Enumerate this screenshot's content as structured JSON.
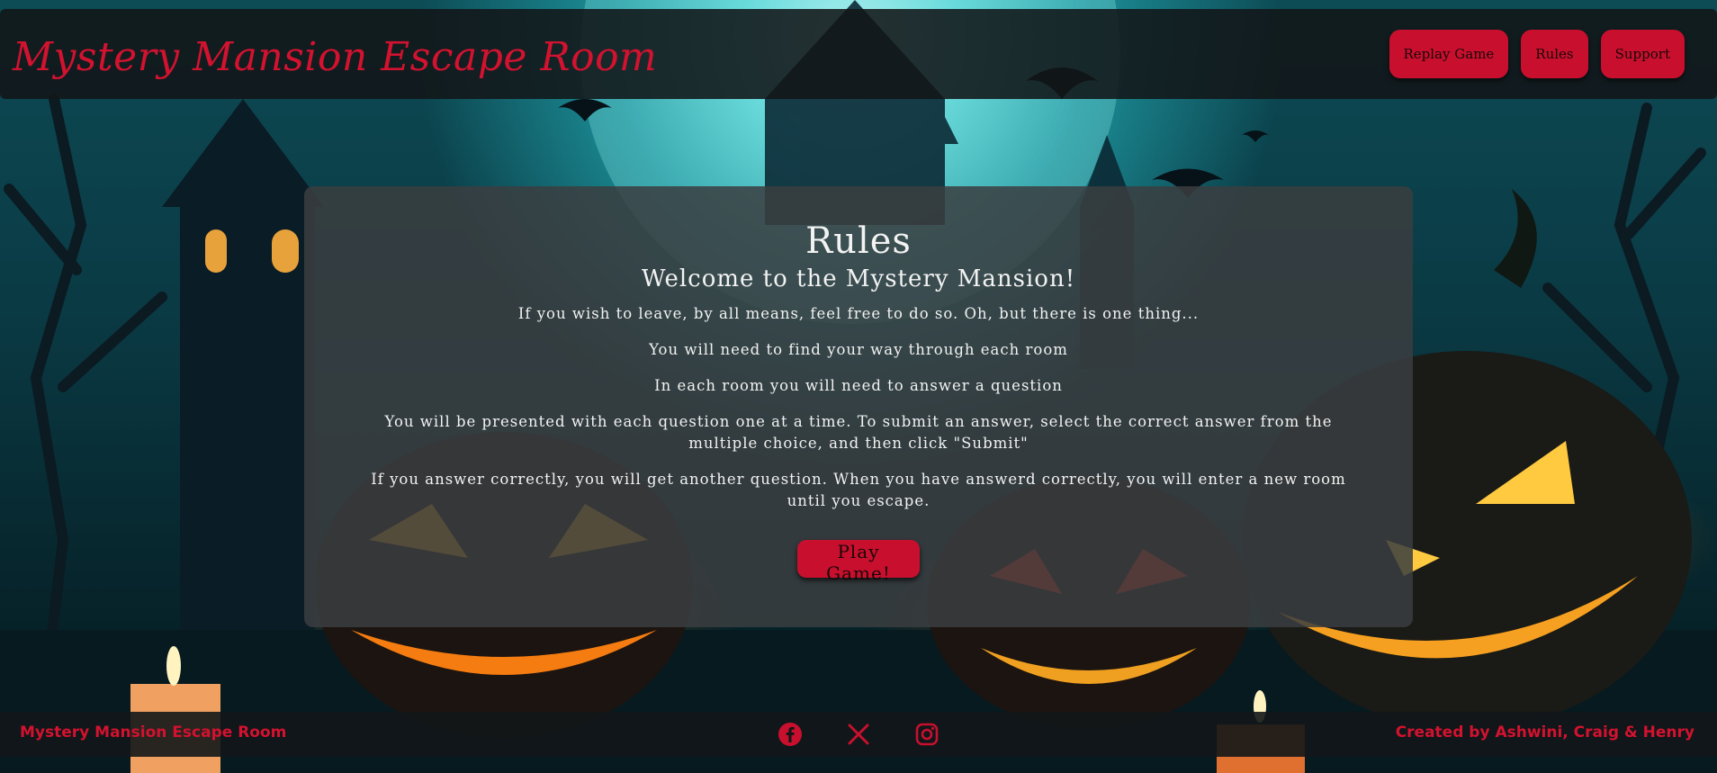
{
  "header": {
    "brand": "Mystery Mansion Escape Room",
    "nav": {
      "replay": "Replay Game",
      "rules": "Rules",
      "support": "Support"
    }
  },
  "rules": {
    "title": "Rules",
    "subtitle": "Welcome to the Mystery Mansion!",
    "paragraphs": [
      "If you wish to leave, by all means, feel free to do so. Oh, but there is one thing...",
      "You will need to find your way through each room",
      "In each room you will need to answer a question",
      "You will be presented with each question one at a time. To submit an answer, select the correct answer from the multiple choice, and then click \"Submit\"",
      "If you answer correctly, you will get another question. When you have answerd correctly, you will enter a new room until you escape."
    ],
    "play_button": "Play Game!"
  },
  "footer": {
    "brand": "Mystery Mansion Escape Room",
    "credits": "Created by Ashwini, Craig & Henry",
    "socials": [
      "facebook-icon",
      "x-icon",
      "instagram-icon"
    ]
  },
  "colors": {
    "accent": "#c8102e",
    "brand_text": "#d3122f",
    "panel": "#3a3e40",
    "bar": "#121618"
  }
}
